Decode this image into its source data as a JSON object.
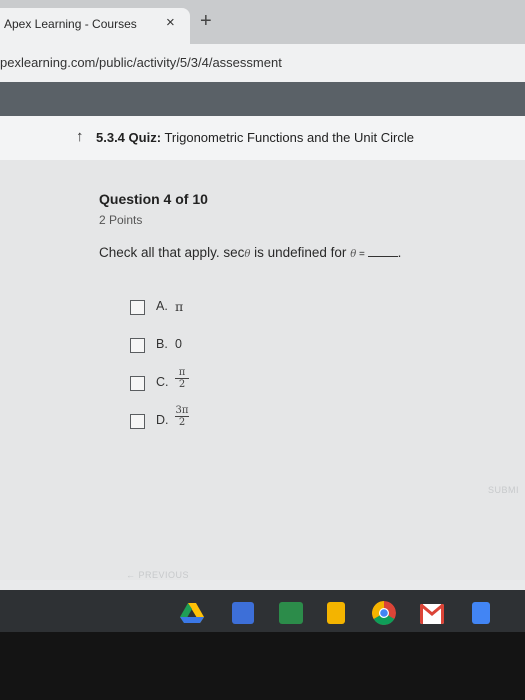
{
  "browser": {
    "tab_title": "Apex Learning - Courses",
    "tab_close": "×",
    "new_tab": "+",
    "url": "pexlearning.com/public/activity/5/3/4/assessment"
  },
  "quiz": {
    "number": "5.3.4",
    "label": "Quiz:",
    "title": "Trigonometric Functions and the Unit Circle"
  },
  "question": {
    "counter": "Question 4 of 10",
    "points": "2 Points",
    "text_prefix": "Check all that apply. sec",
    "text_mid": " is undefined for ",
    "theta": "θ",
    "equals": " = ",
    "period": "."
  },
  "options": [
    {
      "letter": "A.",
      "value": "π"
    },
    {
      "letter": "B.",
      "value": "0"
    },
    {
      "letter": "C.",
      "num": "π",
      "den": "2"
    },
    {
      "letter": "D.",
      "num": "3π",
      "den": "2"
    }
  ],
  "buttons": {
    "submit": "SUBMI",
    "previous": "← PREVIOUS"
  },
  "colors": {
    "header_band": "#5a6167",
    "shelf": "#2e3134"
  },
  "shelf_icons": [
    "drive-icon",
    "calendar-icon",
    "classroom-icon",
    "slides-icon",
    "chrome-icon",
    "gmail-icon",
    "docs-icon"
  ]
}
